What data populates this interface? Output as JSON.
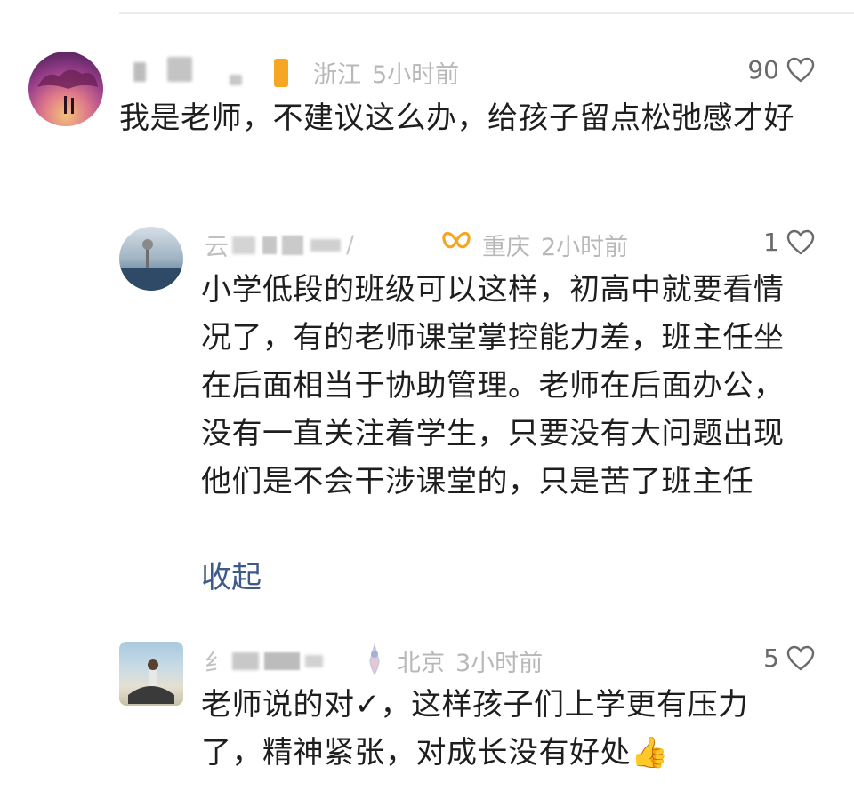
{
  "comments": [
    {
      "location": "浙江",
      "time": "5小时前",
      "likes": "90",
      "text": "我是老师，不建议这么办，给孩子留点松弛感才好"
    },
    {
      "location": "重庆",
      "time": "2小时前",
      "likes": "1",
      "text": "小学低段的班级可以这样，初高中就要看情况了，有的老师课堂掌控能力差，班主任坐在后面相当于协助管理。老师在后面办公，没有一直关注着学生，只要没有大问题出现他们是不会干涉课堂的，只是苦了班主任",
      "collapse_label": "收起"
    },
    {
      "location": "北京",
      "time": "3小时前",
      "likes": "5",
      "text": "老师说的对✓，这样孩子们上学更有压力了，精神紧张，对成长没有好处👍"
    }
  ],
  "colors": {
    "meta_gray": "#b8b8b8",
    "link_blue": "#3d5a8a",
    "badge_orange": "#f5a623"
  }
}
